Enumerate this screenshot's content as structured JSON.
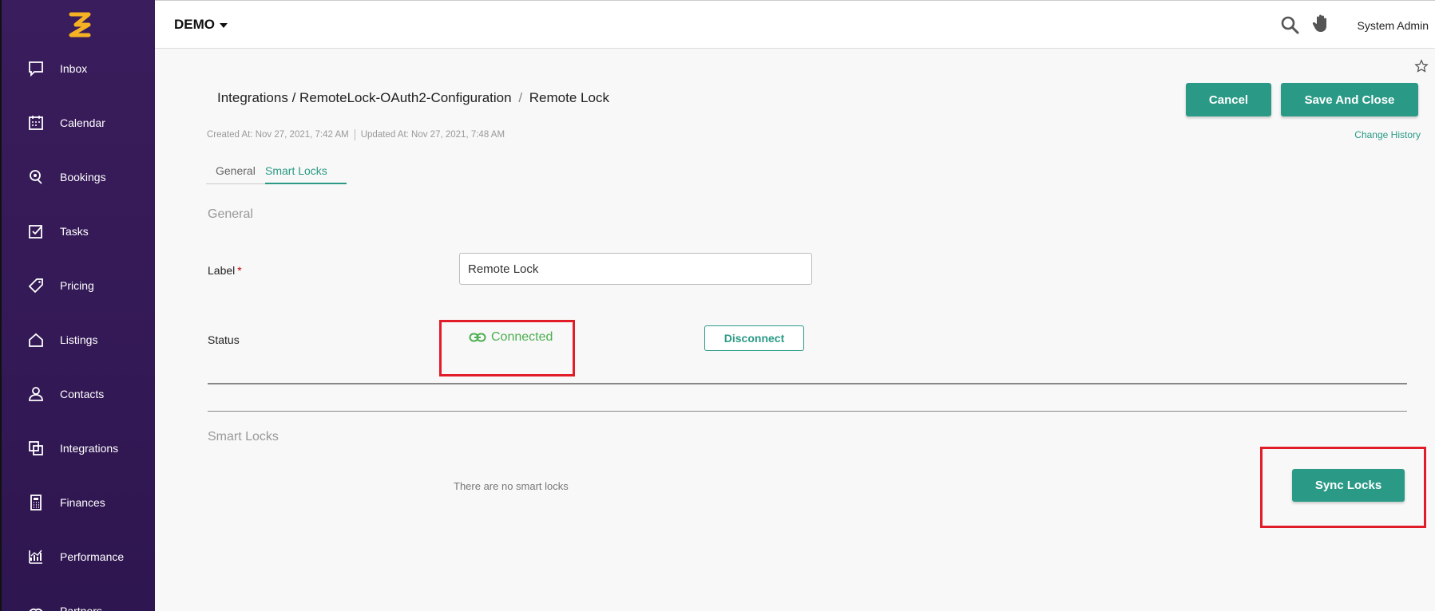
{
  "sidebar": {
    "items": [
      {
        "label": "Inbox",
        "icon": "inbox-icon"
      },
      {
        "label": "Calendar",
        "icon": "calendar-icon"
      },
      {
        "label": "Bookings",
        "icon": "bookings-icon"
      },
      {
        "label": "Tasks",
        "icon": "tasks-icon"
      },
      {
        "label": "Pricing",
        "icon": "price-tag-icon"
      },
      {
        "label": "Listings",
        "icon": "home-icon"
      },
      {
        "label": "Contacts",
        "icon": "user-icon"
      },
      {
        "label": "Integrations",
        "icon": "integrations-icon"
      },
      {
        "label": "Finances",
        "icon": "calculator-icon"
      },
      {
        "label": "Performance",
        "icon": "chart-icon"
      },
      {
        "label": "Partners",
        "icon": "partners-icon"
      }
    ]
  },
  "topbar": {
    "account": "DEMO",
    "user": "System Admin"
  },
  "breadcrumb": {
    "root": "Integrations",
    "parent": "RemoteLock-OAuth2-Configuration",
    "current": "Remote Lock",
    "sep1": "/",
    "sep2": "/"
  },
  "meta": {
    "created": "Created At: Nov 27, 2021, 7:42 AM",
    "updated": "Updated At: Nov 27, 2021, 7:48 AM"
  },
  "actions": {
    "cancel": "Cancel",
    "save": "Save And Close",
    "history": "Change History"
  },
  "tabs": {
    "general": "General",
    "smart_locks": "Smart Locks"
  },
  "form": {
    "section_general": "General",
    "label_field": "Label",
    "required_mark": "*",
    "label_value": "Remote Lock",
    "status_field": "Status",
    "status_value": "Connected",
    "disconnect": "Disconnect"
  },
  "smart_locks": {
    "section_title": "Smart Locks",
    "empty": "There are no smart locks",
    "sync": "Sync Locks"
  },
  "colors": {
    "accent": "#2a9a86",
    "sidebar": "#3a1d5c",
    "connected": "#4caf50",
    "highlight": "#e11d2a",
    "logo": "#f5b324"
  }
}
